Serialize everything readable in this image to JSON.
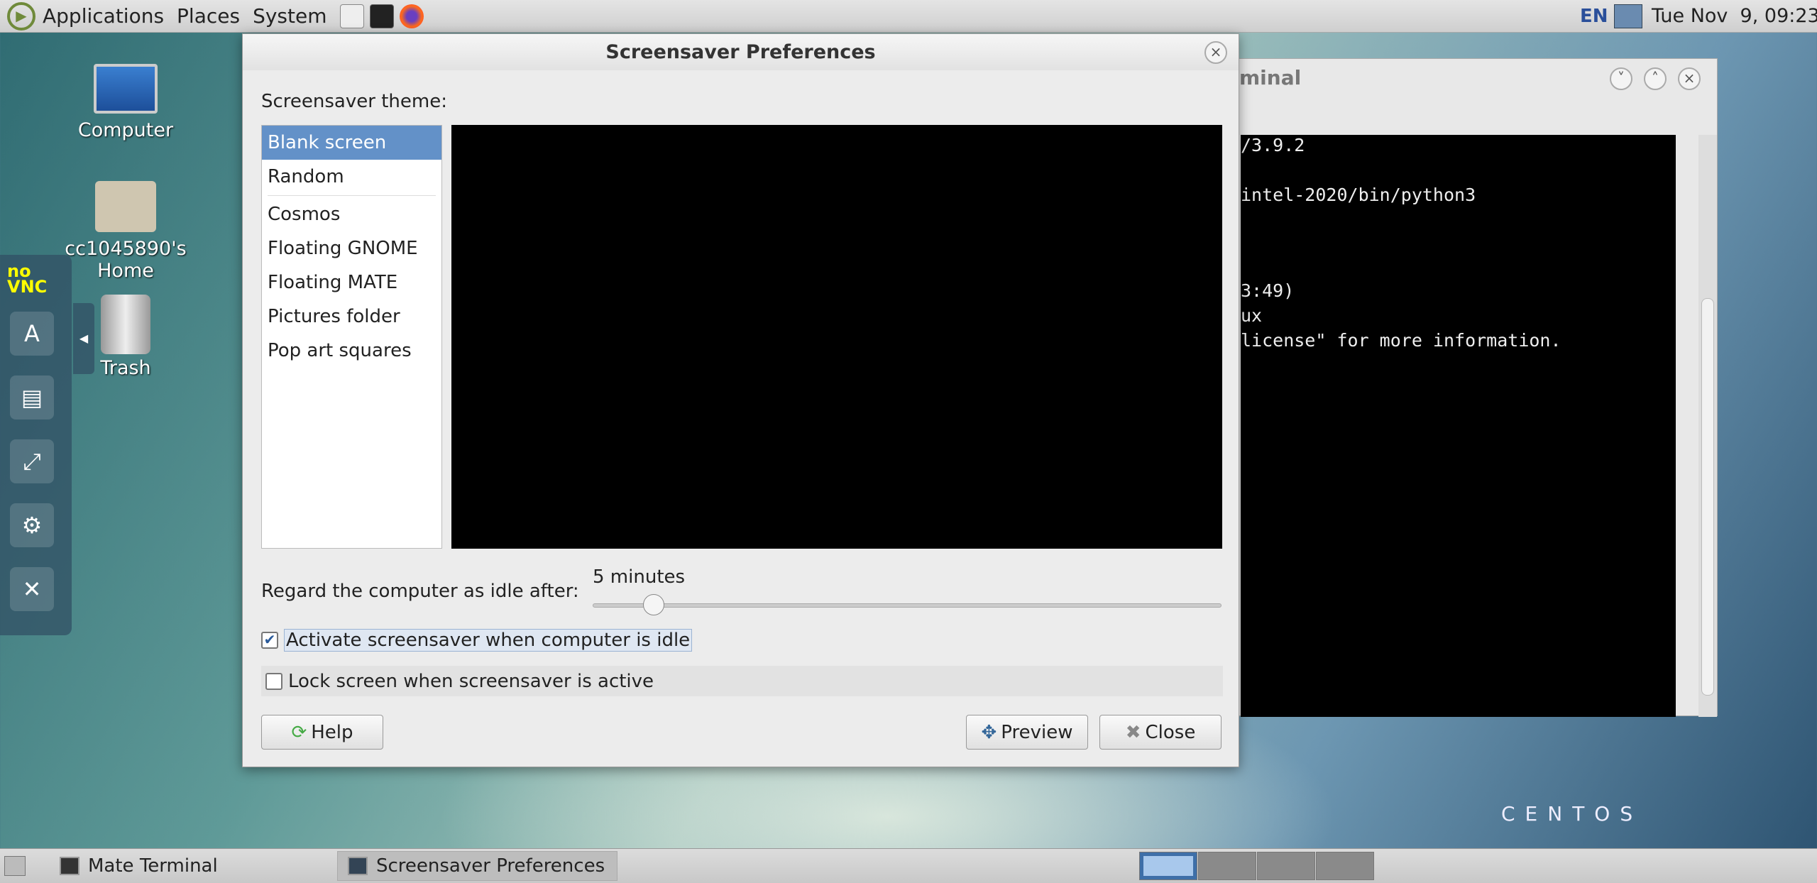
{
  "top_panel": {
    "menus": [
      "Applications",
      "Places",
      "System"
    ],
    "keyboard_layout": "EN",
    "clock": "Tue Nov  9, 09:23"
  },
  "desktop": {
    "icons": [
      {
        "label": "Computer"
      },
      {
        "label": "cc1045890's Home"
      },
      {
        "label": "Trash"
      }
    ],
    "watermark": "CENTOS"
  },
  "novnc": {
    "logo": "noVNC",
    "buttons": [
      "keyboard-icon",
      "clipboard-icon",
      "fullscreen-icon",
      "settings-icon",
      "disconnect-icon"
    ]
  },
  "dialog": {
    "title": "Screensaver Preferences",
    "theme_label": "Screensaver theme:",
    "themes": [
      "Blank screen",
      "Random",
      "Cosmos",
      "Floating GNOME",
      "Floating MATE",
      "Pictures folder",
      "Pop art squares"
    ],
    "selected_theme": "Blank screen",
    "idle_label": "Regard the computer as idle after:",
    "idle_value": "5 minutes",
    "idle_slider_fraction": 0.05,
    "activate_label": "Activate screensaver when computer is idle",
    "activate_checked": true,
    "lock_label": "Lock screen when screensaver is active",
    "lock_checked": false,
    "help": "Help",
    "preview": "Preview",
    "close": "Close"
  },
  "terminal": {
    "title": "minal",
    "lines": [
      "/3.9.2",
      "intel-2020/bin/python3",
      "3:49)",
      "ux",
      "license\" for more information."
    ]
  },
  "taskbar": {
    "tasks": [
      "Mate Terminal",
      "Screensaver Preferences"
    ],
    "workspaces": 4,
    "active_workspace": 1
  }
}
